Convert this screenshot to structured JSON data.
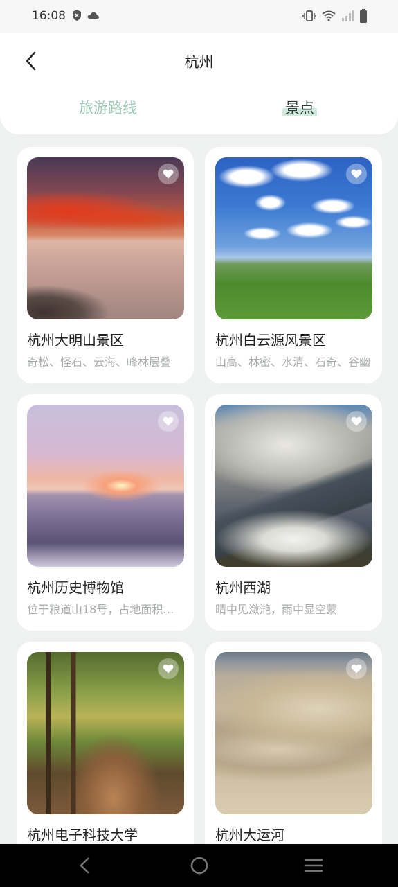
{
  "status_bar": {
    "time": "16:08",
    "icons_left": [
      "shield-icon",
      "cloud-icon"
    ],
    "icons_right": [
      "vibrate-icon",
      "wifi-icon",
      "signal-icon",
      "battery-icon"
    ]
  },
  "header": {
    "title": "杭州",
    "back_icon": "back-arrow-icon"
  },
  "tabs": [
    {
      "label": "旅游路线",
      "active": false
    },
    {
      "label": "景点",
      "active": true
    }
  ],
  "colors": {
    "accent": "#9cc7b4",
    "accent_highlight": "#cfe9de",
    "background": "#eff1f0",
    "card": "#ffffff"
  },
  "cards": [
    {
      "title": "杭州大明山景区",
      "desc": "奇松、怪石、云海、峰林层叠",
      "favorite_icon": "heart-icon"
    },
    {
      "title": "杭州白云源风景区",
      "desc": "山高、林密、水清、石奇、谷幽",
      "favorite_icon": "heart-icon"
    },
    {
      "title": "杭州历史博物馆",
      "desc": "位于粮道山18号，占地面积约…",
      "favorite_icon": "heart-icon"
    },
    {
      "title": "杭州西湖",
      "desc": "晴中见潋滟，雨中显空蒙",
      "favorite_icon": "heart-icon"
    },
    {
      "title": "杭州电子科技大学",
      "desc": "",
      "favorite_icon": "heart-icon"
    },
    {
      "title": "杭州大运河",
      "desc": "",
      "favorite_icon": "heart-icon"
    }
  ],
  "nav_bar": {
    "buttons": [
      "back-triangle-icon",
      "home-circle-icon",
      "menu-icon"
    ]
  }
}
